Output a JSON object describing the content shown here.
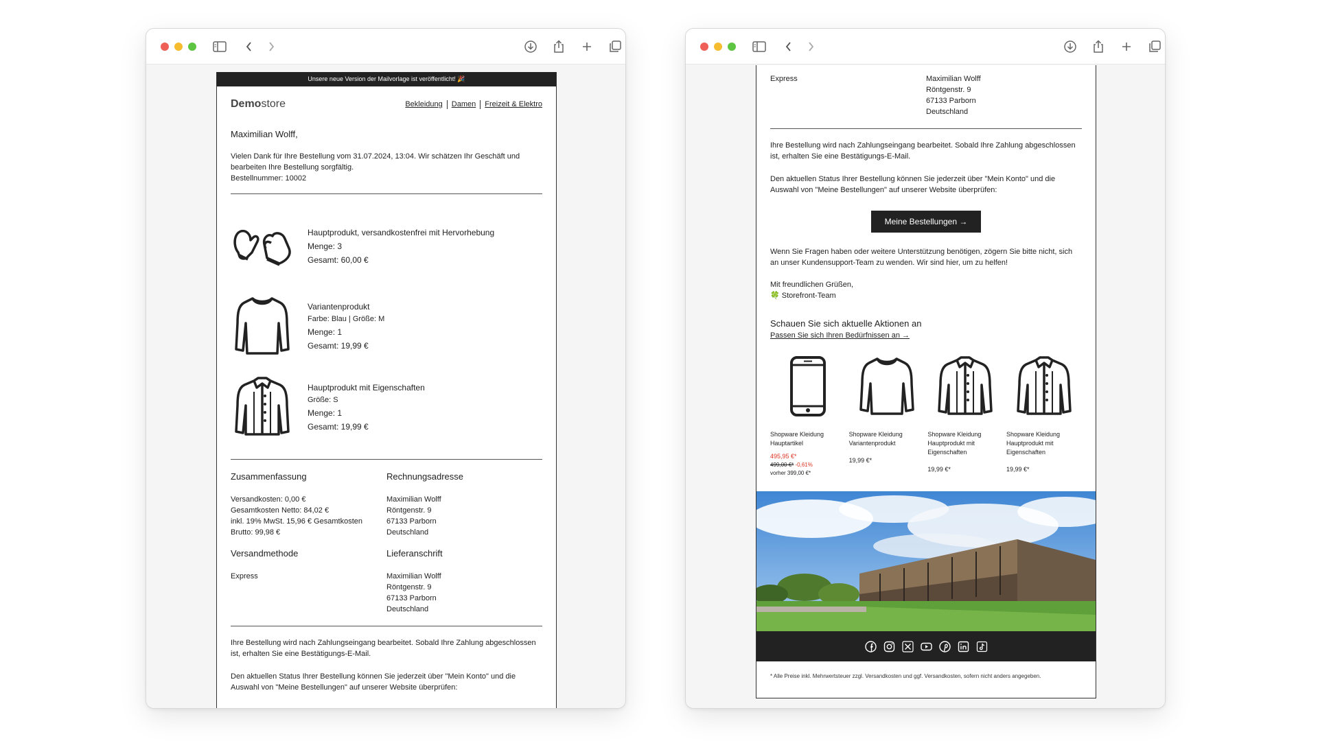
{
  "left": {
    "banner": "Unsere neue Version der Mailvorlage ist veröffentlicht! 🎉",
    "logo_bold": "Demo",
    "logo_light": "store",
    "nav": [
      "Bekleidung",
      "Damen",
      "Freizeit & Elektro"
    ],
    "greeting": "Maximilian Wolff,",
    "intro_1": "Vielen Dank für Ihre Bestellung vom 31.07.2024, 13:04. Wir schätzen Ihr Geschäft und bearbeiten Ihre Bestellung sorgfältig.",
    "intro_2": "Bestellnummer: 10002",
    "items": [
      {
        "title": "Hauptprodukt, versandkostenfrei mit Hervorhebung",
        "variant": "",
        "qty": "Menge: 3",
        "total": "Gesamt: 60,00 €",
        "icon": "mittens-icon"
      },
      {
        "title": "Variantenprodukt",
        "variant": "Farbe: Blau | Größe: M",
        "qty": "Menge: 1",
        "total": "Gesamt: 19,99 €",
        "icon": "sweater-icon"
      },
      {
        "title": "Hauptprodukt mit Eigenschaften",
        "variant": "Größe: S",
        "qty": "Menge: 1",
        "total": "Gesamt: 19,99 €",
        "icon": "jacket-icon"
      }
    ],
    "summary_h": "Zusammenfassung",
    "summary": [
      "Versandkosten: 0,00 €",
      "Gesamtkosten Netto: 84,02 €",
      "inkl. 19% MwSt. 15,96 € Gesamtkosten",
      "Brutto: 99,98 €"
    ],
    "billing_h": "Rechnungsadresse",
    "billing": [
      "Maximilian Wolff",
      "Röntgenstr. 9",
      "67133 Parborn",
      "Deutschland"
    ],
    "shipmethod_h": "Versandmethode",
    "shipmethod": "Express",
    "shipping_h": "Lieferanschrift",
    "shipping": [
      "Maximilian Wolff",
      "Röntgenstr. 9",
      "67133 Parborn",
      "Deutschland"
    ],
    "para_1": "Ihre Bestellung wird nach Zahlungseingang bearbeitet. Sobald Ihre Zahlung abgeschlossen ist, erhalten Sie eine Bestätigungs-E-Mail.",
    "para_2": "Den aktuellen Status Ihrer Bestellung können Sie jederzeit über \"Mein Konto\" und die Auswahl von \"Meine Bestellungen\" auf unserer Website überprüfen:"
  },
  "right": {
    "shipmethod": "Express",
    "shipping": [
      "Maximilian Wolff",
      "Röntgenstr. 9",
      "67133 Parborn",
      "Deutschland"
    ],
    "para_1": "Ihre Bestellung wird nach Zahlungseingang bearbeitet. Sobald Ihre Zahlung abgeschlossen ist, erhalten Sie eine Bestätigungs-E-Mail.",
    "para_2": "Den aktuellen Status Ihrer Bestellung können Sie jederzeit über \"Mein Konto\" und die Auswahl von \"Meine Bestellungen\" auf unserer Website überprüfen:",
    "button": "Meine Bestellungen →",
    "para_3": "Wenn Sie Fragen haben oder weitere Unterstützung benötigen, zögern Sie bitte nicht, sich an unser Kundensupport-Team zu wenden. Wir sind hier, um zu helfen!",
    "closing": "Mit freundlichen Grüßen,",
    "team": "🍀 Storefront-Team",
    "promo_h": "Schauen Sie sich aktuelle Aktionen an",
    "promo_link": "Passen Sie sich Ihren Bedürfnissen an →",
    "products": [
      {
        "name": "Shopware Kleidung Hauptartikel",
        "price": "495,95 €*",
        "old": "499,00 €*",
        "discount": "-0,61%",
        "before": "vorher 399,00 €*",
        "icon": "smartphone-icon"
      },
      {
        "name": "Shopware Kleidung Variantenprodukt",
        "price": "19,99 €*",
        "icon": "sweater-icon"
      },
      {
        "name": "Shopware Kleidung Hauptprodukt mit Eigenschaften",
        "price": "19,99 €*",
        "icon": "jacket-icon"
      },
      {
        "name": "Shopware Kleidung Hauptprodukt mit Eigenschaften",
        "price": "19,99 €*",
        "icon": "jacket-icon"
      }
    ],
    "social": [
      "facebook-icon",
      "instagram-icon",
      "x-icon",
      "youtube-icon",
      "pinterest-icon",
      "linkedin-icon",
      "tiktok-icon"
    ],
    "footnote": "* Alle Preise inkl. Mehrwertsteuer zzgl. Versandkosten und ggf. Versandkosten, sofern nicht anders angegeben."
  },
  "colors": {
    "dark": "#222222",
    "sale": "#dd3322",
    "traffic_red": "#ee5f58",
    "traffic_yellow": "#f6bc30",
    "traffic_green": "#5dc542"
  }
}
